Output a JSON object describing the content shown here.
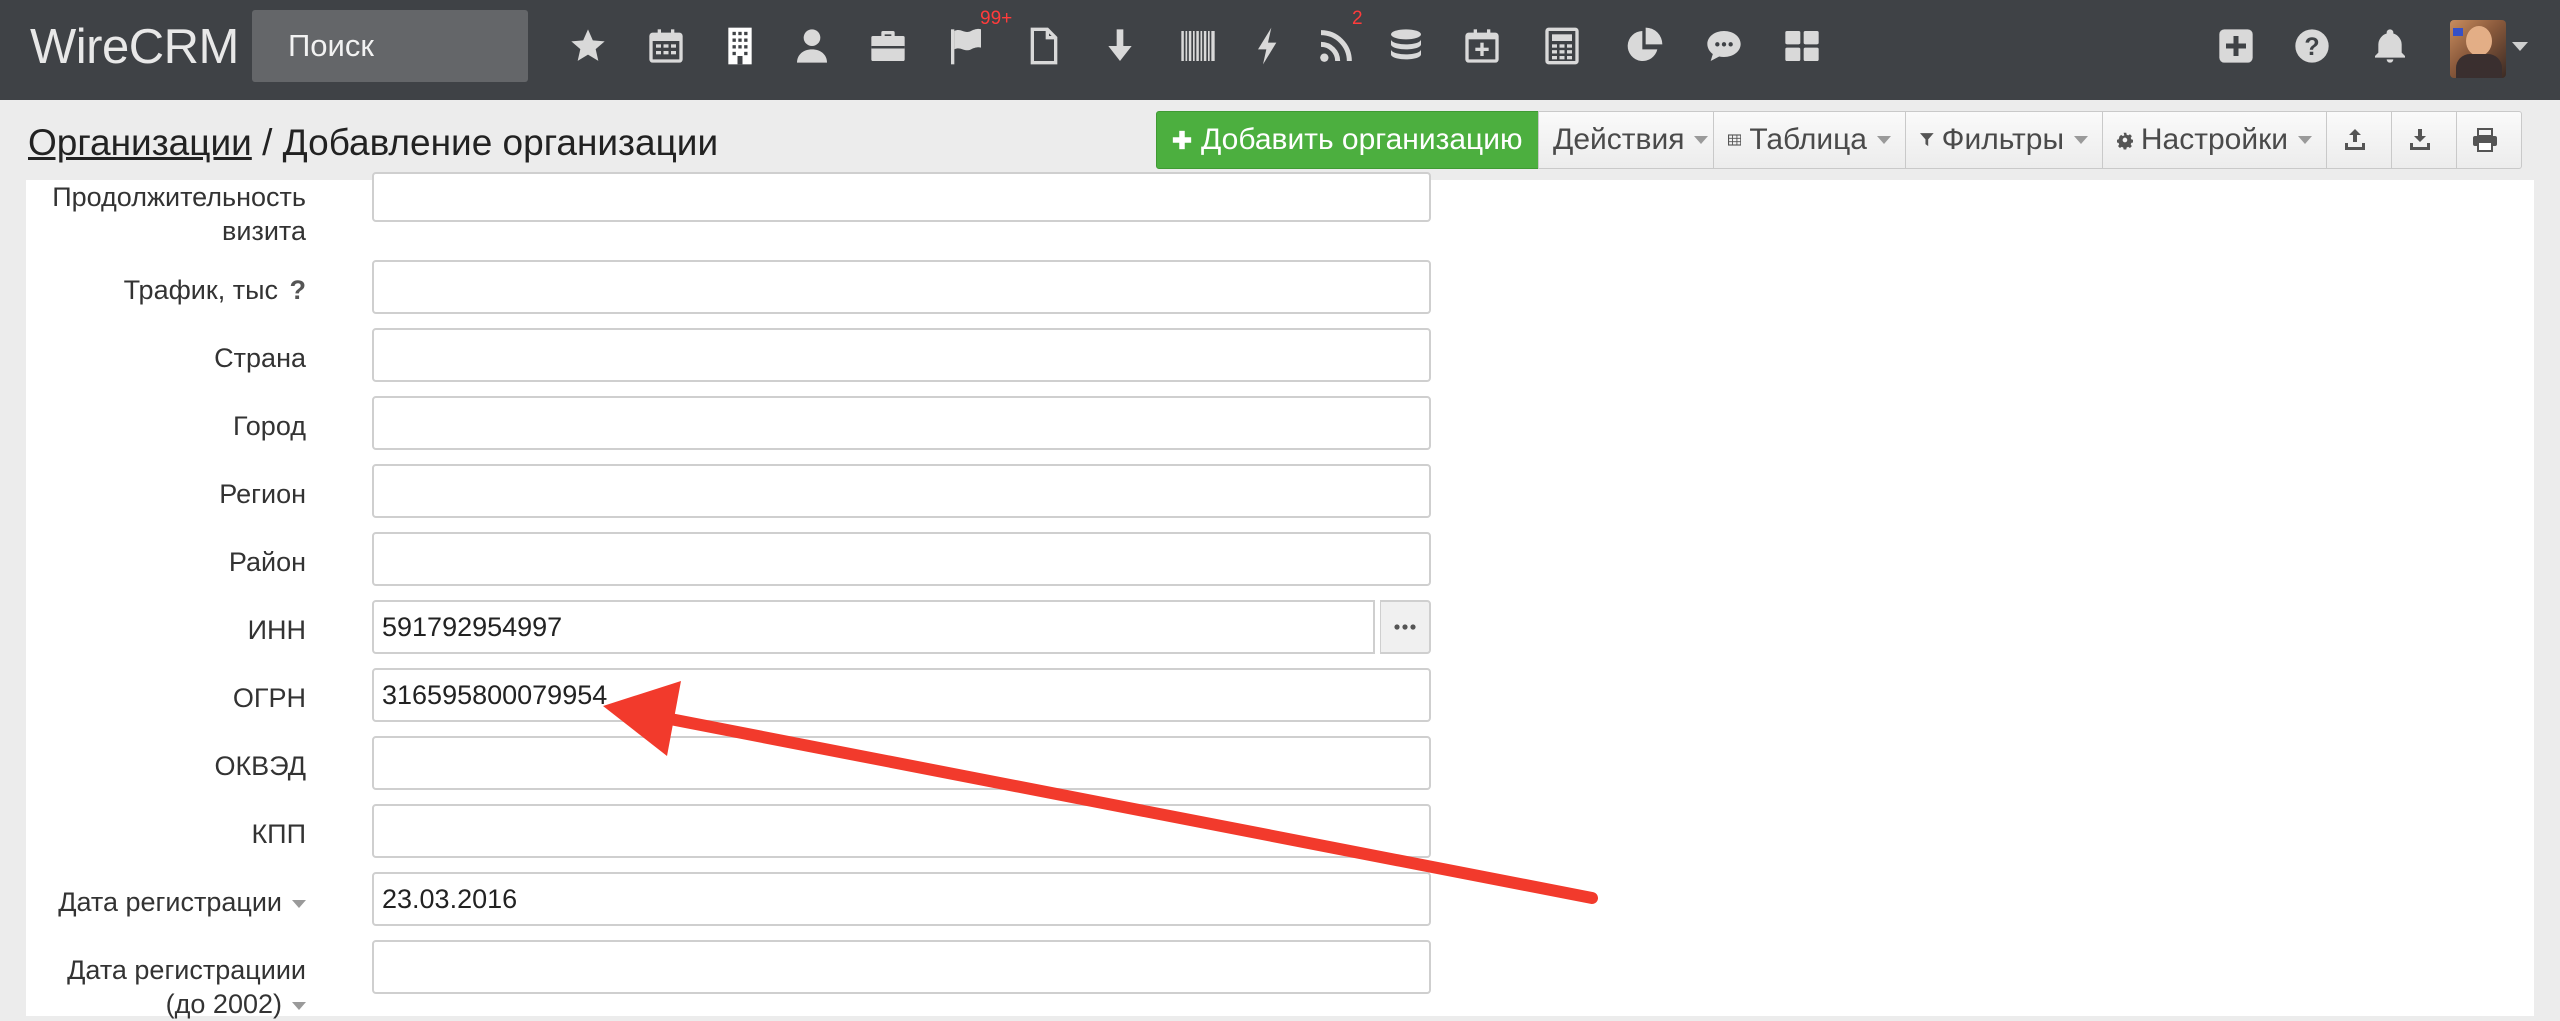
{
  "app": {
    "logo": "WireCRM"
  },
  "search": {
    "placeholder": "Поиск"
  },
  "nav": {
    "icons": [
      "star-icon",
      "calendar-icon",
      "building-icon",
      "user-icon",
      "briefcase-icon",
      "flag-icon",
      "document-icon",
      "download-arrow-icon",
      "barcode-icon",
      "lightning-icon",
      "rss-icon",
      "database-icon",
      "calendar-plus-icon",
      "calculator-icon",
      "pie-chart-icon",
      "chat-icon",
      "grid-icon"
    ],
    "flag_badge": "99+",
    "rss_badge": "2",
    "right_icons": [
      "plus-square-icon",
      "help-icon",
      "bell-icon"
    ]
  },
  "breadcrumb": {
    "parent": "Организации",
    "separator": " / ",
    "current": "Добавление организации"
  },
  "toolbar": {
    "add": "Добавить организацию",
    "actions": "Действия",
    "table": "Таблица",
    "filters": "Фильтры",
    "settings": "Настройки"
  },
  "form": {
    "visit_duration_label_1": "Продолжительность",
    "visit_duration_label_2": "визита",
    "traffic_label": "Трафик, тыс",
    "traffic_help": "?",
    "country_label": "Страна",
    "city_label": "Город",
    "region_label": "Регион",
    "district_label": "Район",
    "inn_label": "ИНН",
    "inn_value": "591792954997",
    "ogrn_label": "ОГРН",
    "ogrn_value": "316595800079954",
    "okved_label": "ОКВЭД",
    "kpp_label": "КПП",
    "reg_date_label": "Дата регистрации",
    "reg_date_value": "23.03.2016",
    "reg_date_old_label_1": "Дата регистрациии",
    "reg_date_old_label_2": "(до 2002)"
  },
  "colors": {
    "navbar": "#3f4246",
    "add_button": "#4caf3f",
    "annotation_arrow": "#f23a2c"
  }
}
